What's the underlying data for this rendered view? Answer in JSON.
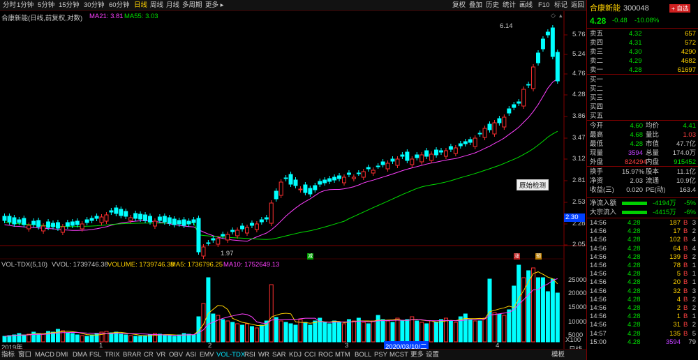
{
  "toolbar": {
    "timeframes": [
      "分时",
      "1分钟",
      "5分钟",
      "15分钟",
      "30分钟",
      "60分钟",
      "日线",
      "周线",
      "月线",
      "多周期",
      "更多 ▸"
    ],
    "active_timeframe": "日线",
    "right_buttons": [
      "复权",
      "叠加",
      "历史",
      "统计",
      "画线",
      "F10",
      "标记",
      "返回"
    ]
  },
  "chart_header": {
    "title": "合康新能(日线,前复权,对数)",
    "ma21": "MA21: 3.81",
    "ma55": "MA55: 3.03"
  },
  "price_axis": [
    "5.76",
    "5.24",
    "4.76",
    "4.28",
    "3.86",
    "3.47",
    "3.12",
    "2.81",
    "2.53",
    "2.28",
    "2.05"
  ],
  "current_price_tag": "2.30",
  "annotations": {
    "high": "6.14",
    "low": "1.97",
    "tooltip": "原始检测",
    "marks": [
      {
        "text": "减",
        "color": "#00c000"
      },
      {
        "text": "涨",
        "color": "#e04040"
      },
      {
        "text": "预",
        "color": "#e0a000"
      }
    ]
  },
  "volume_header": {
    "indicator": "VOL-TDX(5,10)",
    "vvol": "VVOL: 1739746.38",
    "volume": "VOLUME: 1739746.38",
    "ma5": "MA5: 1736796.25",
    "ma10": "MA10: 1752649.13"
  },
  "volume_axis": [
    "25000",
    "20000",
    "15000",
    "10000",
    "5000"
  ],
  "volume_unit": "X100",
  "date_axis": {
    "labels": [
      "2019年",
      "1",
      "2",
      "3",
      "4"
    ],
    "cursor_date": "2020/03/10/二",
    "period": "日线"
  },
  "bottom_tabs": [
    "指标",
    "窗口",
    "MACD",
    "DMI",
    "DMA",
    "FSL",
    "TRIX",
    "BRAR",
    "CR",
    "VR",
    "OBV",
    "ASI",
    "EMV",
    "VOL-TDX",
    "RSI",
    "WR",
    "SAR",
    "KDJ",
    "CCI",
    "ROC",
    "MTM",
    "BOLL",
    "PSY",
    "MCST",
    "更多",
    "设置"
  ],
  "active_tab": "VOL-TDX",
  "template_label": "模板",
  "stock": {
    "name": "合康新能",
    "code": "300048",
    "add_button": "+ 自选",
    "price": "4.28",
    "change": "-0.48",
    "change_pct": "-10.08%"
  },
  "order_book": {
    "asks": [
      {
        "label": "卖五",
        "price": "4.32",
        "vol": "657"
      },
      {
        "label": "卖四",
        "price": "4.31",
        "vol": "572"
      },
      {
        "label": "卖三",
        "price": "4.30",
        "vol": "4290"
      },
      {
        "label": "卖二",
        "price": "4.29",
        "vol": "4682"
      },
      {
        "label": "卖一",
        "price": "4.28",
        "vol": "61697"
      }
    ],
    "bids": [
      {
        "label": "买一",
        "price": "",
        "vol": ""
      },
      {
        "label": "买二",
        "price": "",
        "vol": ""
      },
      {
        "label": "买三",
        "price": "",
        "vol": ""
      },
      {
        "label": "买四",
        "price": "",
        "vol": ""
      },
      {
        "label": "买五",
        "price": "",
        "vol": ""
      }
    ]
  },
  "quote_stats": [
    {
      "l1": "今开",
      "v1": "4.60",
      "c1": "#00e000",
      "l2": "均价",
      "v2": "4.41",
      "c2": "#00e000"
    },
    {
      "l1": "最高",
      "v1": "4.68",
      "c1": "#00e000",
      "l2": "量比",
      "v2": "1.03",
      "c2": "#ff4040"
    },
    {
      "l1": "最低",
      "v1": "4.28",
      "c1": "#00e000",
      "l2": "市值",
      "v2": "47.7亿",
      "c2": "#c8c8c8"
    },
    {
      "l1": "现量",
      "v1": "3594",
      "c1": "#c040ff",
      "l2": "总量",
      "v2": "174.0万",
      "c2": "#c8c8c8"
    },
    {
      "l1": "外盘",
      "v1": "824294",
      "c1": "#ff4040",
      "l2": "内盘",
      "v2": "915452",
      "c2": "#00e000"
    }
  ],
  "fundamentals": [
    {
      "l1": "换手",
      "v1": "15.97%",
      "l2": "股本",
      "v2": "11.1亿"
    },
    {
      "l1": "净资",
      "v1": "2.03",
      "l2": "流通",
      "v2": "10.9亿"
    },
    {
      "l1": "收益(三)",
      "v1": "0.020",
      "l2": "PE(动)",
      "v2": "163.4"
    }
  ],
  "flows": [
    {
      "label": "净流入额",
      "value": "-4194万",
      "pct": "-5%"
    },
    {
      "label": "大宗流入",
      "value": "-4415万",
      "pct": "-6%"
    }
  ],
  "ticks": [
    {
      "t": "14:56",
      "p": "4.28",
      "v": "187",
      "s": "B",
      "n": "3"
    },
    {
      "t": "14:56",
      "p": "4.28",
      "v": "17",
      "s": "B",
      "n": "2"
    },
    {
      "t": "14:56",
      "p": "4.28",
      "v": "102",
      "s": "B",
      "n": "4"
    },
    {
      "t": "14:56",
      "p": "4.28",
      "v": "64",
      "s": "B",
      "n": "4"
    },
    {
      "t": "14:56",
      "p": "4.28",
      "v": "139",
      "s": "B",
      "n": "2"
    },
    {
      "t": "14:56",
      "p": "4.28",
      "v": "78",
      "s": "B",
      "n": "1"
    },
    {
      "t": "14:56",
      "p": "4.28",
      "v": "5",
      "s": "B",
      "n": "1"
    },
    {
      "t": "14:56",
      "p": "4.28",
      "v": "20",
      "s": "B",
      "n": "1"
    },
    {
      "t": "14:56",
      "p": "4.28",
      "v": "32",
      "s": "B",
      "n": "3"
    },
    {
      "t": "14:56",
      "p": "4.28",
      "v": "4",
      "s": "B",
      "n": "2"
    },
    {
      "t": "14:56",
      "p": "4.28",
      "v": "2",
      "s": "B",
      "n": "2"
    },
    {
      "t": "14:56",
      "p": "4.28",
      "v": "1",
      "s": "B",
      "n": "1"
    },
    {
      "t": "14:56",
      "p": "4.28",
      "v": "31",
      "s": "B",
      "n": "2"
    },
    {
      "t": "14:57",
      "p": "4.28",
      "v": "135",
      "s": "B",
      "n": "5"
    },
    {
      "t": "15:00",
      "p": "4.28",
      "v": "3594",
      "s": "",
      "n": "79"
    }
  ],
  "colors": {
    "up": "#ff3030",
    "down": "#00ffff",
    "ma21": "#ff40ff",
    "ma55": "#00e000",
    "vol_ma5": "#ffd200",
    "vol_ma10": "#ff40ff",
    "frame": "#800000"
  }
}
